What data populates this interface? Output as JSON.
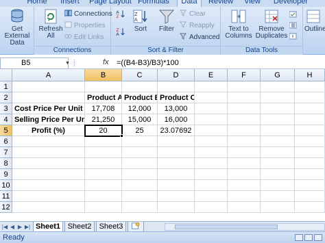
{
  "ribbon": {
    "tabs": [
      "Home",
      "Insert",
      "Page Layout",
      "Formulas",
      "Data",
      "Review",
      "View",
      "Developer"
    ],
    "active_tab": "Data",
    "groups": {
      "get_external": {
        "label": "Get External\nData"
      },
      "connections": {
        "label": "Connections",
        "refresh_label": "Refresh\nAll",
        "connections_label": "Connections",
        "properties_label": "Properties",
        "edit_links_label": "Edit Links"
      },
      "sort_filter": {
        "label": "Sort & Filter",
        "sort_label": "Sort",
        "filter_label": "Filter",
        "clear_label": "Clear",
        "reapply_label": "Reapply",
        "advanced_label": "Advanced"
      },
      "data_tools": {
        "label": "Data Tools",
        "text_to_columns_label": "Text to\nColumns",
        "remove_duplicates_label": "Remove\nDuplicates"
      },
      "outline": {
        "label": "Outline"
      }
    }
  },
  "formula_bar": {
    "name_box": "B5",
    "fx_label": "fx",
    "formula": "=((B4-B3)/B3)*100"
  },
  "sheet": {
    "columns": [
      "A",
      "B",
      "C",
      "D",
      "E",
      "F",
      "G",
      "H"
    ],
    "selected_column": "B",
    "rows": [
      "1",
      "2",
      "3",
      "4",
      "5",
      "6",
      "7",
      "8",
      "9",
      "10",
      "11",
      "12"
    ],
    "selected_row": "5",
    "cells": {
      "b2": "Product A",
      "c2": "Product B",
      "d2": "Product C",
      "a3": "Cost Price Per Unit",
      "b3": "17,708",
      "c3": "12,000",
      "d3": "13,000",
      "a4": "Selling Price Per Unit",
      "b4": "21,250",
      "c4": "15,000",
      "d4": "16,000",
      "a5": "Profit (%)",
      "b5": "20",
      "c5": "25",
      "d5": "23.07692"
    }
  },
  "sheet_tabs": [
    "Sheet1",
    "Sheet2",
    "Sheet3"
  ],
  "active_sheet": "Sheet1",
  "status": {
    "ready": "Ready"
  }
}
